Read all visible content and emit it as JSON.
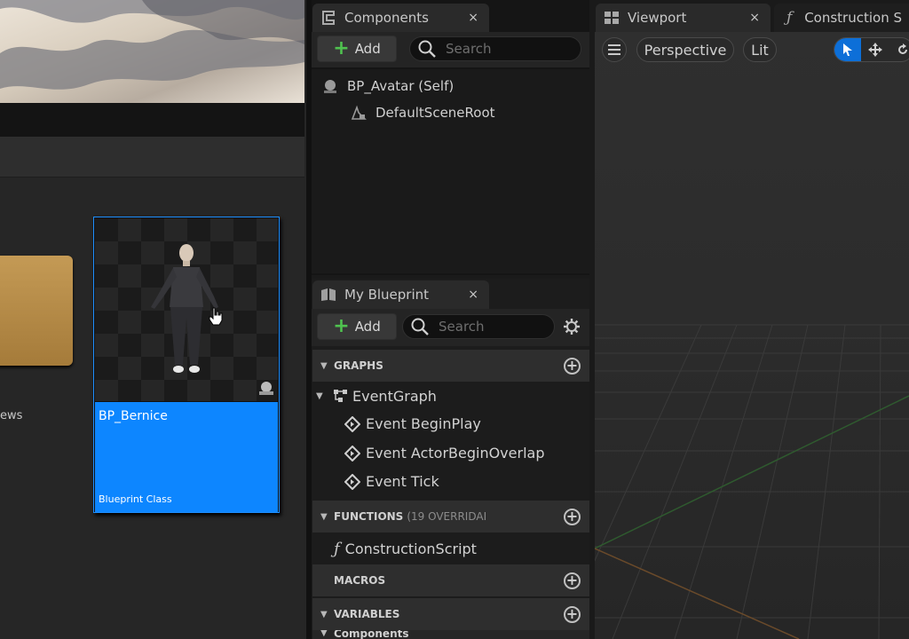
{
  "content_browser": {
    "folder_label_partial": "ews",
    "asset": {
      "name": "BP_Bernice",
      "type": "Blueprint Class"
    }
  },
  "components_panel": {
    "tab_label": "Components",
    "close": "×",
    "add_label": "Add",
    "search_placeholder": "Search",
    "tree": [
      {
        "label": "BP_Avatar (Self)"
      },
      {
        "label": "DefaultSceneRoot"
      }
    ]
  },
  "my_blueprint_panel": {
    "tab_label": "My Blueprint",
    "close": "×",
    "add_label": "Add",
    "search_placeholder": "Search",
    "sections": {
      "graphs": {
        "title": "GRAPHS"
      },
      "functions": {
        "title": "FUNCTIONS",
        "subtitle": "(19 OVERRIDAI"
      },
      "macros": {
        "title": "MACROS"
      },
      "variables": {
        "title": "VARIABLES"
      },
      "components": {
        "title": "Components"
      }
    },
    "event_graph": "EventGraph",
    "events": [
      "Event BeginPlay",
      "Event ActorBeginOverlap",
      "Event Tick"
    ],
    "functions": [
      "ConstructionScript"
    ]
  },
  "viewport": {
    "tab_label": "Viewport",
    "close": "×",
    "construction_tab_label": "Construction S",
    "perspective_label": "Perspective",
    "lit_label": "Lit"
  },
  "colors": {
    "accent": "#0d86ff",
    "add_plus": "#4fc24f",
    "viewport_bg": "#2f2f2f",
    "folder": "#b88c48"
  }
}
